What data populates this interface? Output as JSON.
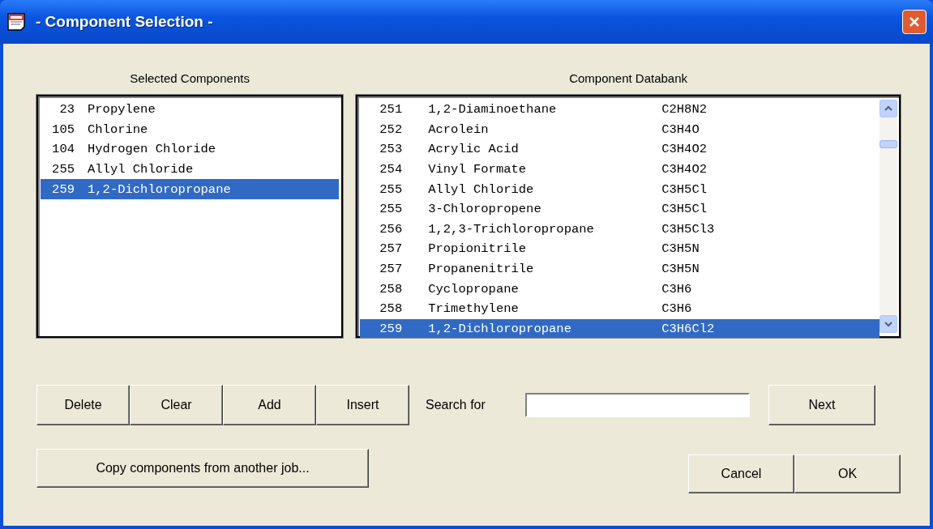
{
  "window": {
    "title": "- Component Selection -"
  },
  "selected_components": {
    "heading": "Selected Components",
    "rows": [
      {
        "number": "23",
        "name": "Propylene",
        "selected": false
      },
      {
        "number": "105",
        "name": "Chlorine",
        "selected": false
      },
      {
        "number": "104",
        "name": "Hydrogen Chloride",
        "selected": false
      },
      {
        "number": "255",
        "name": "Allyl Chloride",
        "selected": false
      },
      {
        "number": "259",
        "name": "1,2-Dichloropropane",
        "selected": true
      }
    ]
  },
  "databank": {
    "heading": "Component Databank",
    "rows": [
      {
        "number": "251",
        "name": "1,2-Diaminoethane",
        "formula": "C2H8N2",
        "selected": false
      },
      {
        "number": "252",
        "name": "Acrolein",
        "formula": "C3H4O",
        "selected": false
      },
      {
        "number": "253",
        "name": "Acrylic Acid",
        "formula": "C3H4O2",
        "selected": false
      },
      {
        "number": "254",
        "name": "Vinyl Formate",
        "formula": "C3H4O2",
        "selected": false
      },
      {
        "number": "255",
        "name": "Allyl Chloride",
        "formula": "C3H5Cl",
        "selected": false
      },
      {
        "number": "255",
        "name": "3-Chloropropene",
        "formula": "C3H5Cl",
        "selected": false
      },
      {
        "number": "256",
        "name": "1,2,3-Trichloropropane",
        "formula": "C3H5Cl3",
        "selected": false
      },
      {
        "number": "257",
        "name": "Propionitrile",
        "formula": "C3H5N",
        "selected": false
      },
      {
        "number": "257",
        "name": "Propanenitrile",
        "formula": "C3H5N",
        "selected": false
      },
      {
        "number": "258",
        "name": "Cyclopropane",
        "formula": "C3H6",
        "selected": false
      },
      {
        "number": "258",
        "name": "Trimethylene",
        "formula": "C3H6",
        "selected": false
      },
      {
        "number": "259",
        "name": "1,2-Dichloropropane",
        "formula": "C3H6Cl2",
        "selected": true
      }
    ]
  },
  "edit_buttons": [
    "Delete",
    "Clear",
    "Add",
    "Insert"
  ],
  "search": {
    "label": "Search for",
    "next_button": "Next"
  },
  "copy_button": "Copy components from another job...",
  "dialog_buttons": [
    "Cancel",
    "OK"
  ]
}
